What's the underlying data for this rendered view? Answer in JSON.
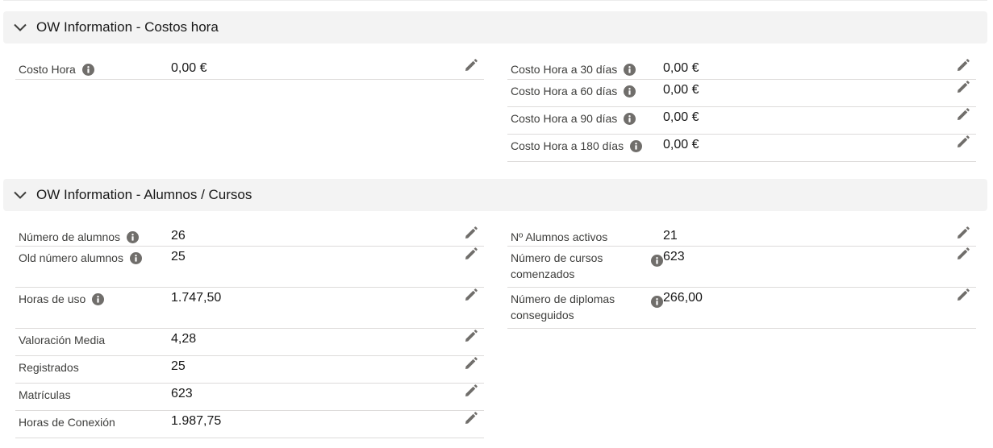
{
  "sections": [
    {
      "title": "OW Information - Costos hora",
      "left_fields": [
        {
          "label": "Costo Hora",
          "value": "0,00 €"
        }
      ],
      "right_fields": [
        {
          "label": "Costo Hora a 30 días",
          "value": "0,00 €"
        },
        {
          "label": "Costo Hora a 60 días",
          "value": "0,00 €"
        },
        {
          "label": "Costo Hora a 90 días",
          "value": "0,00 €"
        },
        {
          "label": "Costo Hora a 180 días",
          "value": "0,00 €"
        }
      ]
    },
    {
      "title": "OW Information - Alumnos / Cursos",
      "left_fields": [
        {
          "label": "Número de alumnos",
          "value": "26"
        },
        {
          "label": "Old número alumnos",
          "value": "25"
        },
        {
          "label": "Horas de uso",
          "value": "1.747,50"
        },
        {
          "label": "Valoración Media",
          "value": "4,28"
        },
        {
          "label": "Registrados",
          "value": "25"
        },
        {
          "label": "Matrículas",
          "value": "623"
        },
        {
          "label": "Horas de Conexión",
          "value": "1.987,75"
        }
      ],
      "right_fields": [
        {
          "label": "Nº Alumnos activos",
          "value": "21"
        },
        {
          "label": "Número de cursos comenzados",
          "value": "623"
        },
        {
          "label": "Número de diplomas conseguidos",
          "value": "266,00"
        }
      ]
    }
  ],
  "icons": {
    "section_toggle": "chevron-down-icon",
    "help": "info-icon",
    "edit": "pencil-icon"
  },
  "colors": {
    "header_background": "#f3f3f3",
    "divider": "#dddbda",
    "icon": "#706e6b",
    "label_text": "#3e3e3c",
    "value_text": "#181818"
  }
}
